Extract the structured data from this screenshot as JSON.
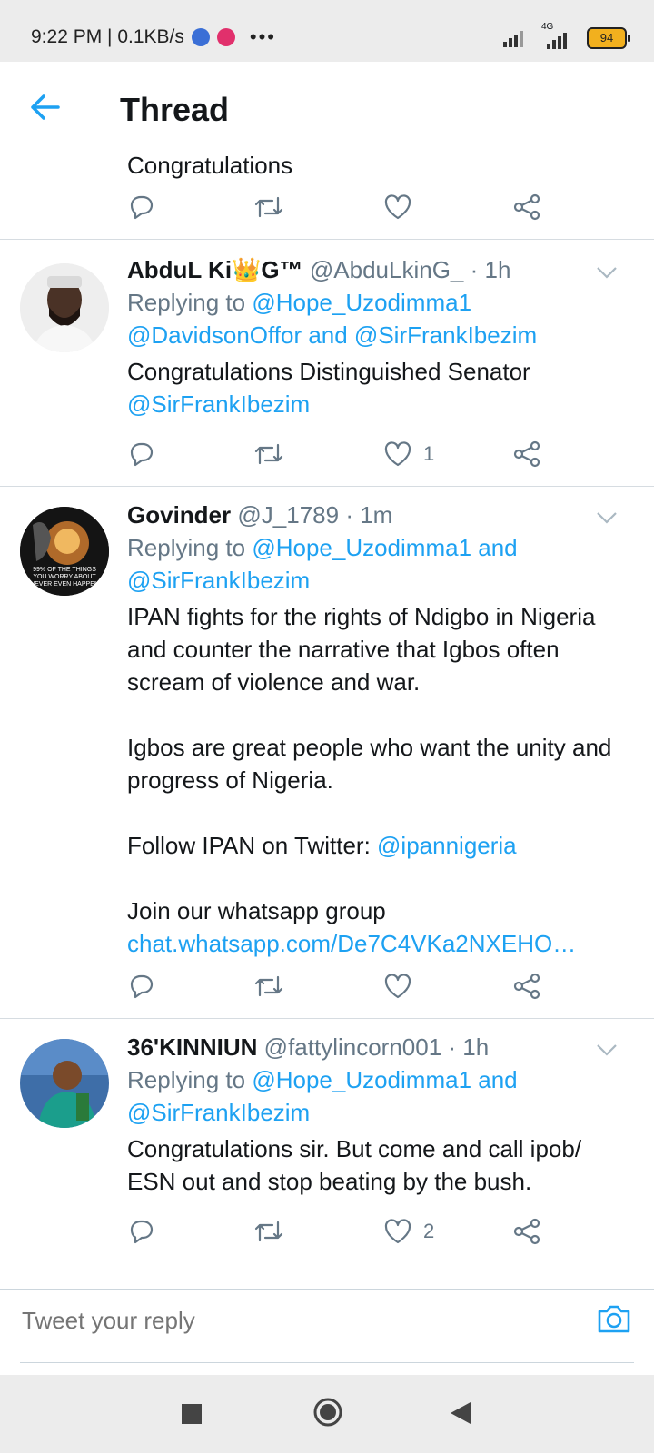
{
  "status_bar": {
    "time_speed": "9:22 PM | 0.1KB/s",
    "more": "•••",
    "network_label": "4G",
    "battery": "94"
  },
  "header": {
    "title": "Thread"
  },
  "tweets": [
    {
      "text_tail": "Congratulations",
      "likes": ""
    },
    {
      "name": "AbduL Ki👑G™",
      "handle": "@AbduLkinG_",
      "time": "· 1h",
      "replying_prefix": "Replying to",
      "replying_line1": "@Hope_Uzodimma1",
      "replying_line2": "@DavidsonOffor and @SirFrankIbezim",
      "body_line1": "Congratulations Distinguished Senator",
      "body_mention": "@SirFrankIbezim",
      "likes": "1"
    },
    {
      "name": "Govinder",
      "handle": "@J_1789",
      "time": "· 1m",
      "avatar_text": "99% OF THE THINGS YOU WORRY ABOUT NEVER EVEN HAPPEN",
      "replying_prefix": "Replying to",
      "replying_line1": "@Hope_Uzodimma1 and",
      "replying_line2": "@SirFrankIbezim",
      "p1_l1": "IPAN fights for the rights of Ndigbo in Nigeria",
      "p1_l2": "and counter the narrative that Igbos often",
      "p1_l3": "scream of violence and war.",
      "p2_l1": "Igbos are great people who want the unity and",
      "p2_l2": "progress of Nigeria.",
      "p3_text": "Follow IPAN on Twitter: ",
      "p3_mention": "@ipannigeria",
      "p4_l1": "Join our whatsapp group",
      "p4_link": "chat.whatsapp.com/De7C4VKa2NXEHO…",
      "likes": ""
    },
    {
      "name": "36'KINNIUN",
      "handle": "@fattylincorn001",
      "time": "· 1h",
      "replying_prefix": "Replying to",
      "replying_line1": "@Hope_Uzodimma1 and",
      "replying_line2": "@SirFrankIbezim",
      "body_line1": "Congratulations sir. But come and call ipob/",
      "body_line2": "ESN out and stop beating by the bush.",
      "likes": "2"
    }
  ],
  "reply": {
    "placeholder": "Tweet your reply"
  },
  "colors": {
    "accent": "#1da1f2",
    "muted": "#657786",
    "text": "#14171a"
  },
  "icons": [
    "back-arrow-icon",
    "reply-icon",
    "retweet-icon",
    "like-icon",
    "share-icon",
    "chevron-down-icon",
    "camera-icon"
  ]
}
